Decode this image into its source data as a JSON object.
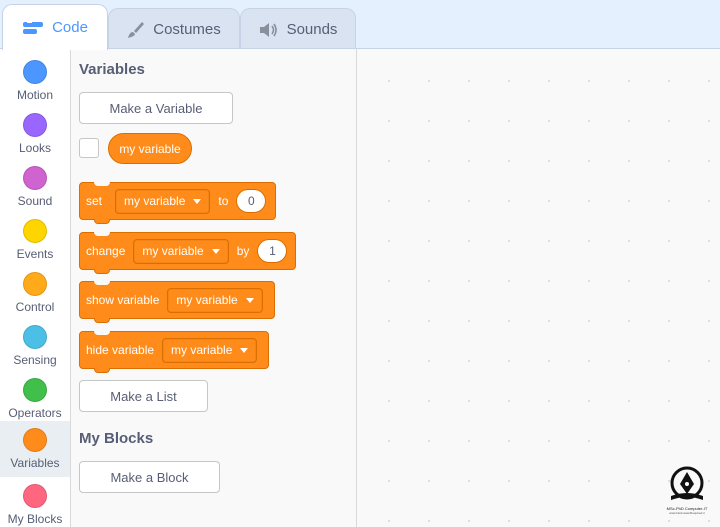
{
  "tabs": [
    {
      "label": "Code",
      "icon": "code-icon",
      "active": true
    },
    {
      "label": "Costumes",
      "icon": "brush-icon",
      "active": false
    },
    {
      "label": "Sounds",
      "icon": "speaker-icon",
      "active": false
    }
  ],
  "categories": [
    {
      "label": "Motion",
      "color": "#4c97ff"
    },
    {
      "label": "Looks",
      "color": "#9966ff"
    },
    {
      "label": "Sound",
      "color": "#cf63cf"
    },
    {
      "label": "Events",
      "color": "#ffd500"
    },
    {
      "label": "Control",
      "color": "#ffab19"
    },
    {
      "label": "Sensing",
      "color": "#4cbfe6"
    },
    {
      "label": "Operators",
      "color": "#40bf4a"
    },
    {
      "label": "Variables",
      "color": "#ff8c1a",
      "selected": true
    },
    {
      "label": "My Blocks",
      "color": "#ff6680"
    }
  ],
  "palette": {
    "variables_title": "Variables",
    "make_variable": "Make a Variable",
    "reporter": "my variable",
    "set_block": {
      "verb": "set",
      "variable": "my variable",
      "to": "to",
      "value": "0"
    },
    "change_block": {
      "verb": "change",
      "variable": "my variable",
      "by": "by",
      "value": "1"
    },
    "show_block": {
      "verb": "show variable",
      "variable": "my variable"
    },
    "hide_block": {
      "verb": "hide variable",
      "variable": "my variable"
    },
    "make_list": "Make a List",
    "myblocks_title": "My Blocks",
    "make_block": "Make a Block"
  },
  "watermark": {
    "line1": "MSc-PhD Computer-IT",
    "line2": "www.NoAnswerRequired.ir"
  },
  "colors": {
    "accent": "#4c97ff",
    "variables": "#ff8c1a",
    "variables_border": "#db6e00"
  }
}
